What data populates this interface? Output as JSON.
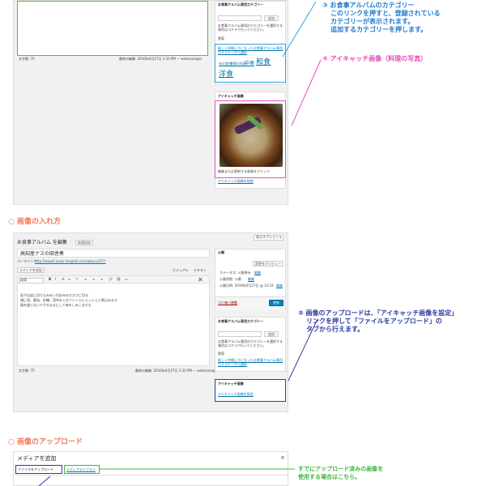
{
  "top": {
    "category_panel_title": "お食事アルバム専用カテゴリー",
    "search_button": "追加",
    "category_desc": "お食事アルバム専用のカテゴリーを選択する場合はコチラで行ってください。",
    "category_radio": "野菜",
    "category_link": "新しく仲間入りになったお食事アルバム専用カテゴリーから選択",
    "word_count": "文字数: 75",
    "last_edited": "最終の編集: 2016年6月27日 2:33 PM — webmanager",
    "tags": [
      "旬の食材",
      "季節の料理",
      "中華",
      "和食",
      "洋食"
    ],
    "eyecatch_title": "アイキャッチ画像",
    "eyecatch_hint": "編集または更新する画像をクリック",
    "eyecatch_remove": "アイキャッチ画像を削除"
  },
  "annotations": {
    "a3_title": "③ お食事アルバムのカテゴリー",
    "a3_lines": [
      "このリンクを押すと、登録されている",
      "カテゴリーが表示されます。",
      "追加するカテゴリーを押します。"
    ],
    "a4": "④ アイキャッチ画像（料理の写真）",
    "a5_lines": [
      "⑤ 画像のアップロードは、「アイキャッチ画像を設定」",
      "リンクを押して「ファイルをアップロード」の",
      "タブから行えます。"
    ],
    "a6_lines": [
      "すでにアップロード済みの画像を",
      "使用する場合はこちら。"
    ]
  },
  "sections": {
    "insert": "○ 画像の入れ方",
    "upload": "○ 画像のアップロード"
  },
  "editor": {
    "screen_options": "表示オプション ▾",
    "heading": "お食事アルバム を編集",
    "add_new": "新規追加",
    "post_title": "高知産ナスの田舎煮",
    "permalink_label": "パーマリンク:",
    "permalink": "http://www4.kaios-hospital.com/album/257/",
    "add_media": "メディアを追加",
    "tab_visual": "ビジュアル",
    "tab_text": "テキスト",
    "format_select": "段落",
    "body_lines": [
      "茄子は皮に切り込みをいれ好みの大きさに切る",
      "鍋に酒、醤油、砂糖、昆布を入れてレンジにふっくらと煮込みます",
      "器を盛らないでそのままにして味をしみこませる"
    ],
    "word_count": "文字数: 75",
    "last_edited": "最終の編集: 2016年6月27日 2:33 PM — webmanager"
  },
  "publish": {
    "title": "公開",
    "preview": "変更をプレビュー",
    "status": "ステータス: 公開済み",
    "status_edit": "編集",
    "visibility": "公開状態: 公開",
    "visibility_edit": "編集",
    "published_on": "公開日時: 2016年6月27日 @ 14:33",
    "published_edit": "編集",
    "trash": "ゴミ箱へ移動",
    "update": "更新"
  },
  "category2": {
    "title": "お食事アルバム専用カテゴリー",
    "button": "追加",
    "desc": "お食事アルバム専用のカテゴリーを選択する場合はコチラで行ってください。",
    "radio": "野菜",
    "link": "新しく仲間入りになったお食事アルバム専用カテゴリーから選択"
  },
  "eyecatch2": {
    "title": "アイキャッチ画像",
    "set_link": "アイキャッチ画像を設定"
  },
  "media": {
    "title": "メディアを追加",
    "tab_upload": "ファイルをアップロード",
    "tab_library": "メディアライブラリ",
    "close": "×"
  }
}
